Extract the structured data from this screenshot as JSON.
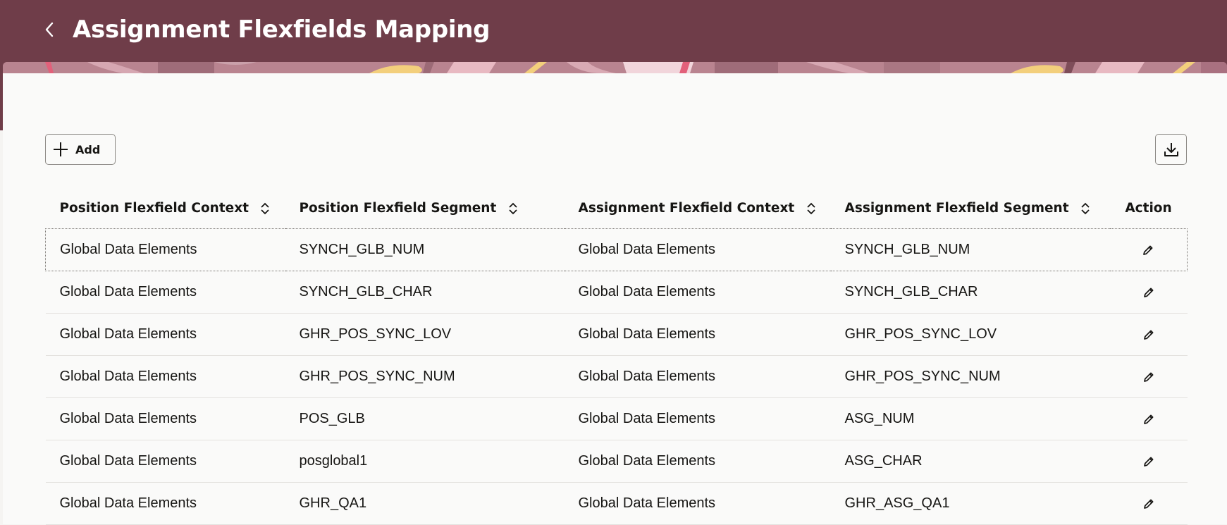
{
  "header": {
    "title": "Assignment Flexfields Mapping",
    "background_color": "#6f3d49",
    "back_icon": "chevron-left-icon"
  },
  "toolbar": {
    "add_label": "Add",
    "add_icon": "plus-icon",
    "export_icon": "download-icon"
  },
  "table": {
    "columns": [
      {
        "label": "Position Flexfield Context",
        "sortable": true
      },
      {
        "label": "Position Flexfield Segment",
        "sortable": true
      },
      {
        "label": "Assignment Flexfield Context",
        "sortable": true
      },
      {
        "label": "Assignment Flexfield Segment",
        "sortable": true
      },
      {
        "label": "Action",
        "sortable": false
      }
    ],
    "rows": [
      [
        "Global Data Elements",
        "SYNCH_GLB_NUM",
        "Global Data Elements",
        "SYNCH_GLB_NUM"
      ],
      [
        "Global Data Elements",
        "SYNCH_GLB_CHAR",
        "Global Data Elements",
        "SYNCH_GLB_CHAR"
      ],
      [
        "Global Data Elements",
        "GHR_POS_SYNC_LOV",
        "Global Data Elements",
        "GHR_POS_SYNC_LOV"
      ],
      [
        "Global Data Elements",
        "GHR_POS_SYNC_NUM",
        "Global Data Elements",
        "GHR_POS_SYNC_NUM"
      ],
      [
        "Global Data Elements",
        "POS_GLB",
        "Global Data Elements",
        "ASG_NUM"
      ],
      [
        "Global Data Elements",
        "posglobal1",
        "Global Data Elements",
        "ASG_CHAR"
      ],
      [
        "Global Data Elements",
        "GHR_QA1",
        "Global Data Elements",
        "GHR_ASG_QA1"
      ]
    ],
    "row_action_icon": "pencil-icon"
  }
}
